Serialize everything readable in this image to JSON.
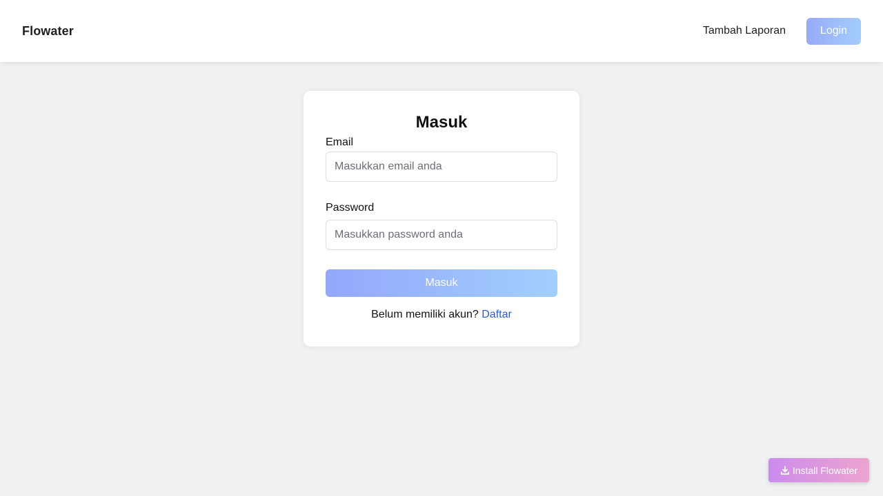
{
  "navbar": {
    "brand": "Flowater",
    "links": {
      "add_report": "Tambah Laporan"
    },
    "login_label": "Login"
  },
  "login_form": {
    "title": "Masuk",
    "email": {
      "label": "Email",
      "value": "",
      "placeholder": "Masukkan email anda"
    },
    "password": {
      "label": "Password",
      "value": "",
      "placeholder": "Masukkan password anda"
    },
    "submit_label": "Masuk",
    "register_prompt": "Belum memiliki akun?",
    "register_link": "Daftar"
  },
  "install": {
    "icon": "download-icon",
    "label": "Install Flowater"
  },
  "colors": {
    "page_background": "#f0f1f3",
    "button_gradient_start": "#93a7fb",
    "button_gradient_end": "#a2cffd",
    "link": "#2a5bd7",
    "install_gradient_start": "#cc8bee",
    "install_gradient_end": "#eea4cf"
  }
}
